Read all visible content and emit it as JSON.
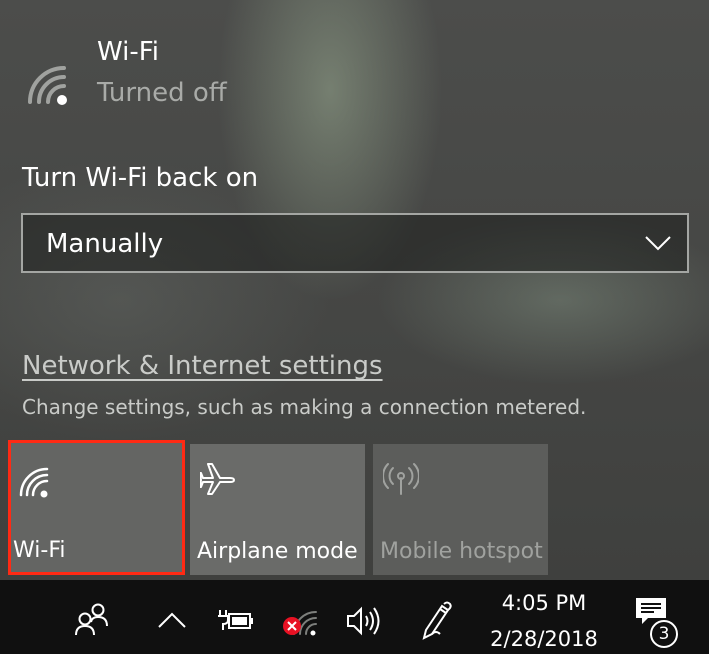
{
  "wifi_panel": {
    "title": "Wi-Fi",
    "status": "Turned off",
    "turn_on_label": "Turn Wi-Fi back on",
    "dropdown_value": "Manually"
  },
  "settings": {
    "link_text": "Network & Internet settings",
    "description": "Change settings, such as making a connection metered."
  },
  "quick_actions": [
    {
      "label": "Wi-Fi",
      "icon": "wifi-icon",
      "state": "off",
      "highlight_color": "#ff2a14"
    },
    {
      "label": "Airplane mode",
      "icon": "airplane-icon",
      "state": "off"
    },
    {
      "label": "Mobile hotspot",
      "icon": "hotspot-icon",
      "state": "disabled"
    }
  ],
  "taskbar": {
    "icons": [
      "people-icon",
      "chevron-up-icon",
      "battery-charging-icon",
      "network-disconnected-icon",
      "volume-icon",
      "pen-icon"
    ],
    "time": "4:05 PM",
    "date": "2/28/2018",
    "notification_count": "3"
  }
}
